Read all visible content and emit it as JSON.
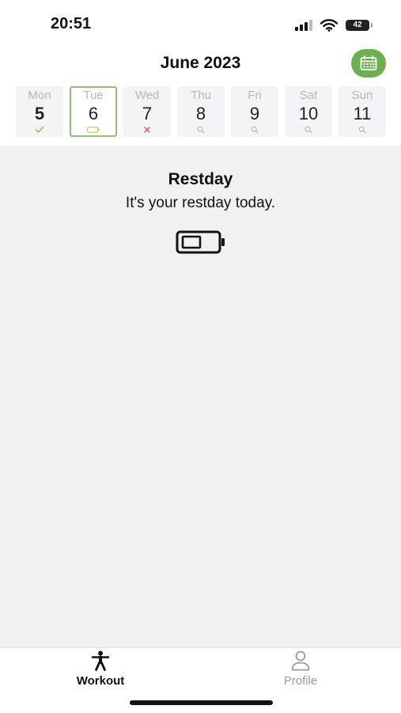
{
  "status_bar": {
    "time": "20:51",
    "battery_level": "42",
    "icons": [
      "cellular-signal-icon",
      "wifi-icon",
      "battery-icon"
    ]
  },
  "header": {
    "month_title": "June 2023",
    "calendar_button_icon": "calendar-icon",
    "accent_color": "#6ab04c"
  },
  "days": [
    {
      "name": "Mon",
      "number": "5",
      "status": "completed",
      "status_icon": "checkmark-icon"
    },
    {
      "name": "Tue",
      "number": "6",
      "status": "restday",
      "status_icon": "battery-icon",
      "selected": true
    },
    {
      "name": "Wed",
      "number": "7",
      "status": "missed",
      "status_icon": "cross-icon"
    },
    {
      "name": "Thu",
      "number": "8",
      "status": "planned",
      "status_icon": "magnifier-icon"
    },
    {
      "name": "Fri",
      "number": "9",
      "status": "planned",
      "status_icon": "magnifier-icon"
    },
    {
      "name": "Sat",
      "number": "10",
      "status": "planned",
      "status_icon": "magnifier-icon"
    },
    {
      "name": "Sun",
      "number": "11",
      "status": "planned",
      "status_icon": "magnifier-icon"
    }
  ],
  "restday": {
    "title": "Restday",
    "subtitle": "It's your restday today.",
    "icon": "battery-icon"
  },
  "tabs": [
    {
      "label": "Workout",
      "icon": "person-figure-icon",
      "active": true
    },
    {
      "label": "Profile",
      "icon": "profile-icon",
      "active": false
    }
  ]
}
